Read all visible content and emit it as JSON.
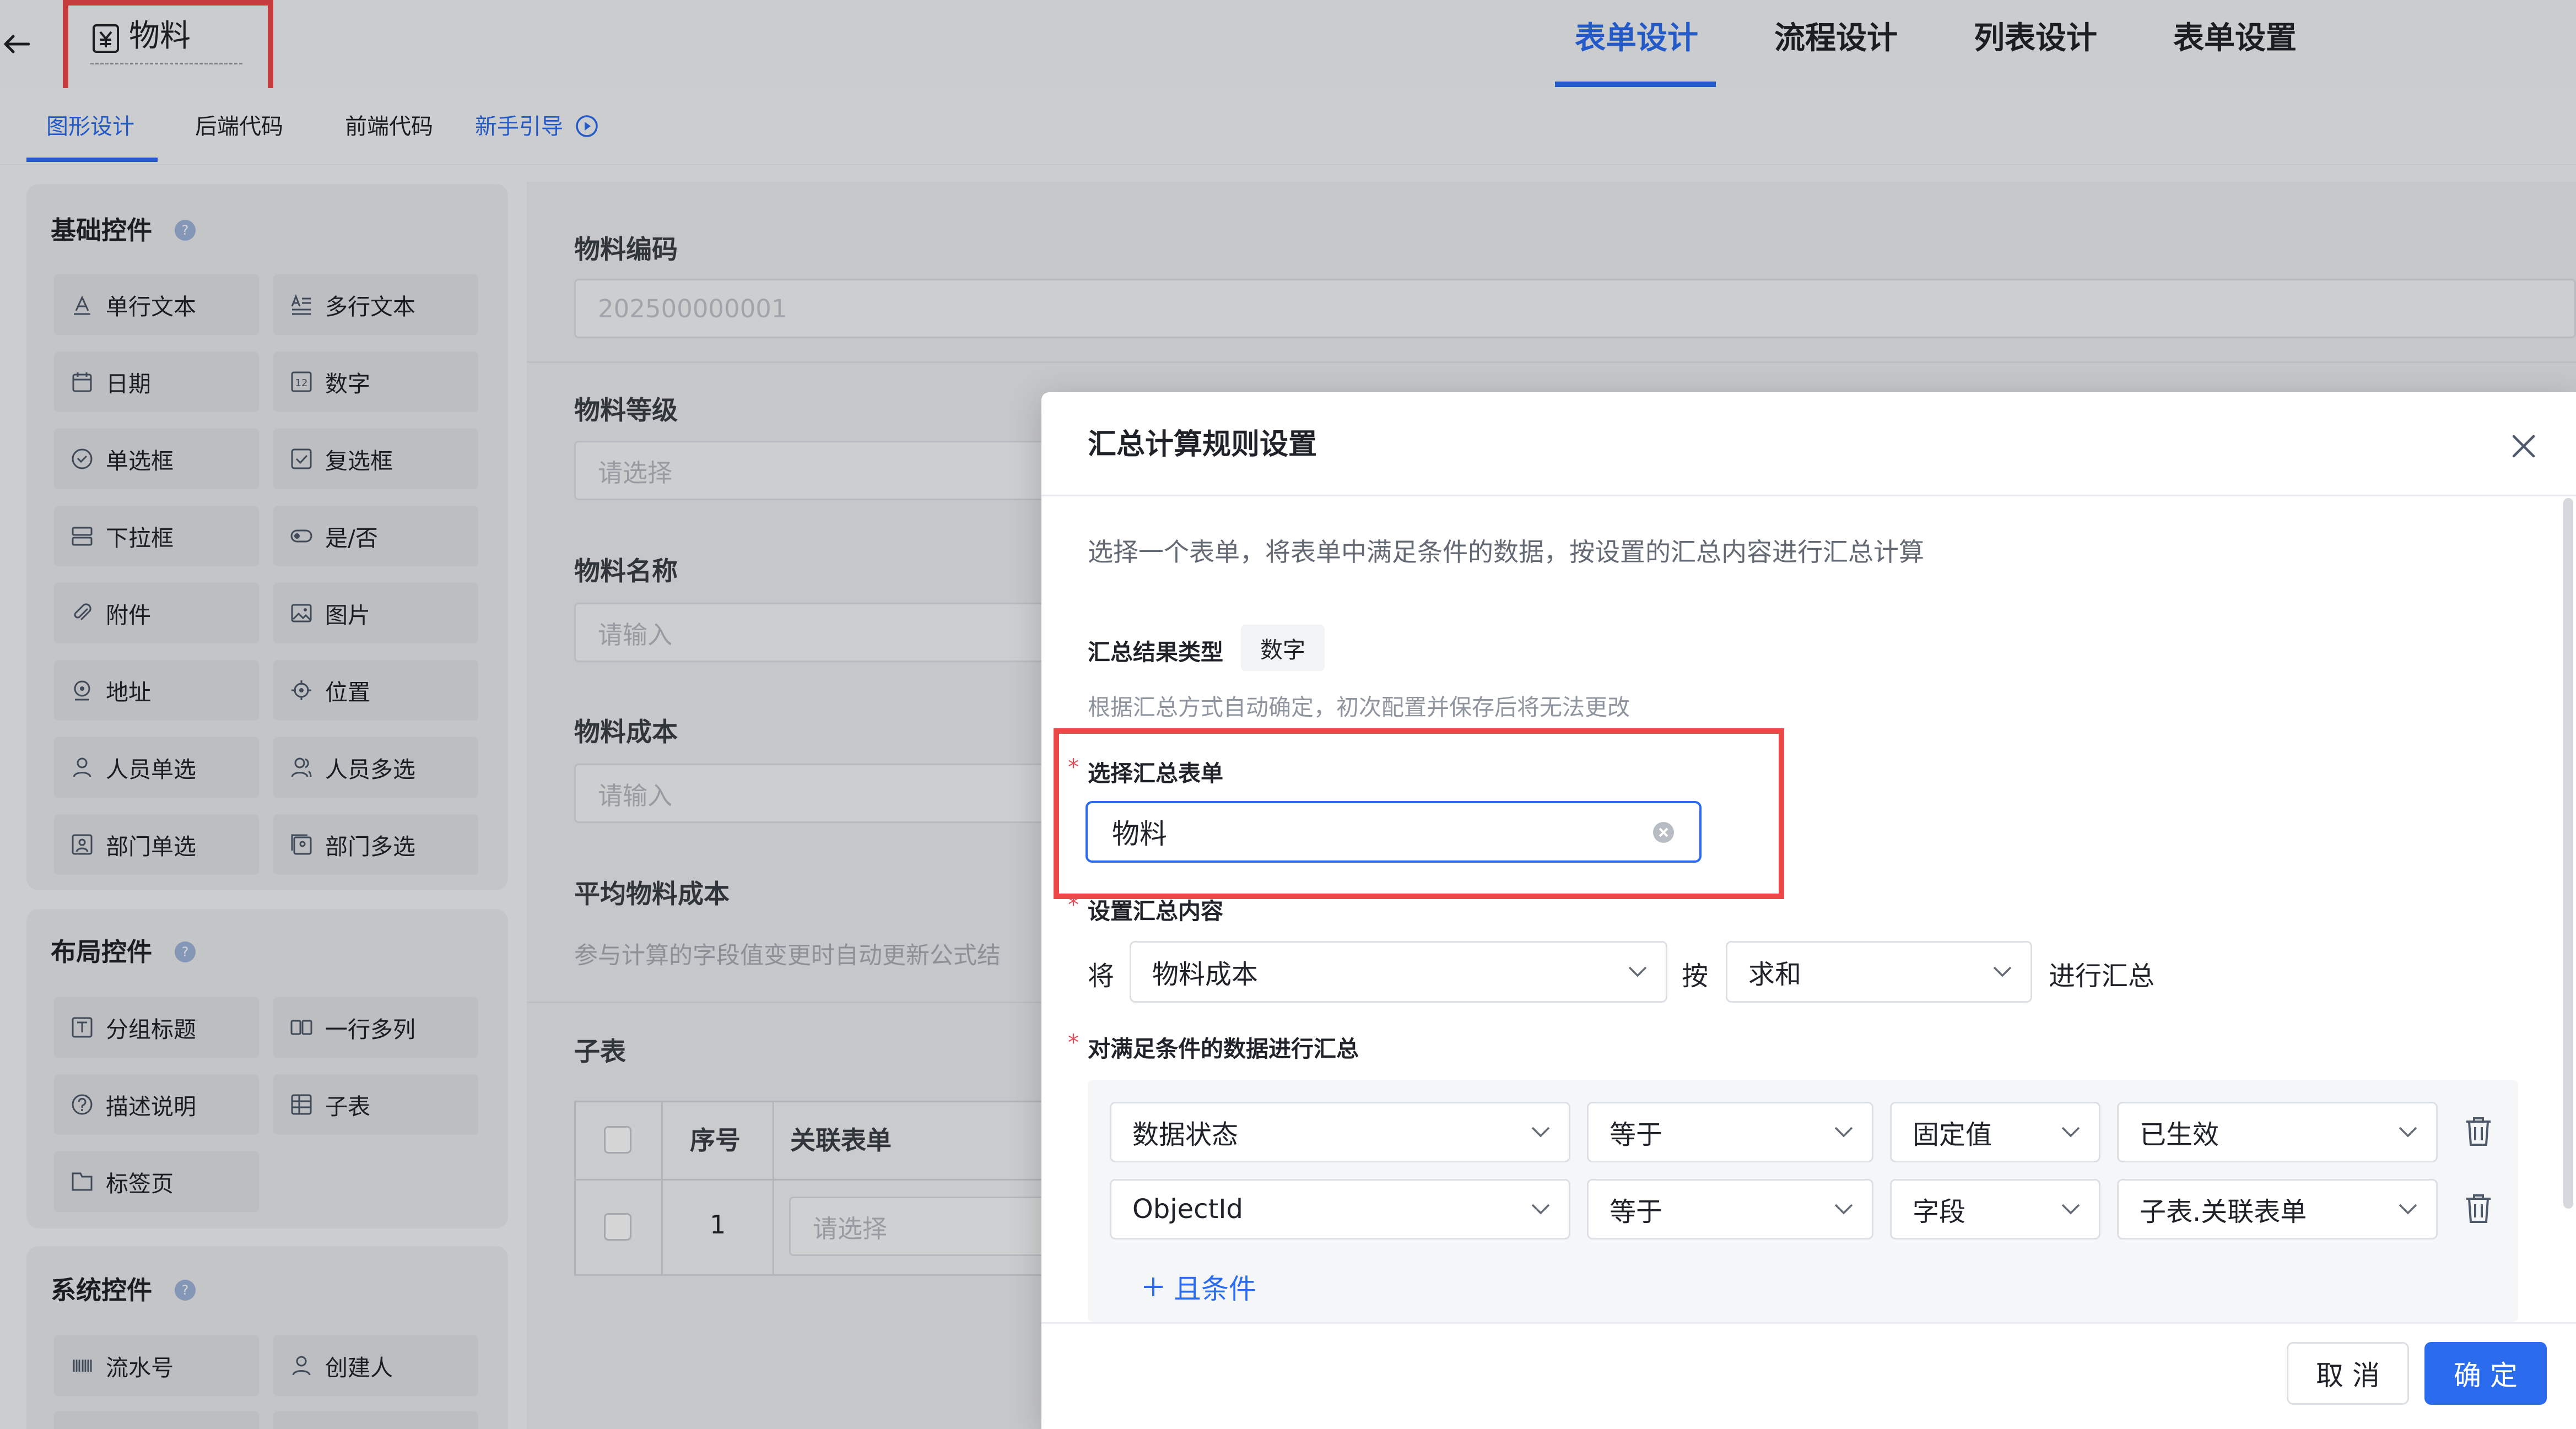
{
  "header": {
    "app_title": "物料",
    "tabs": [
      {
        "label": "表单设计",
        "active": true
      },
      {
        "label": "流程设计",
        "active": false
      },
      {
        "label": "列表设计",
        "active": false
      },
      {
        "label": "表单设置",
        "active": false
      }
    ]
  },
  "subtabs": [
    {
      "label": "图形设计",
      "active": true
    },
    {
      "label": "后端代码",
      "active": false
    },
    {
      "label": "前端代码",
      "active": false
    },
    {
      "label": "新手引导",
      "active": false,
      "icon": "play-circle-icon"
    }
  ],
  "palette": {
    "basic": {
      "title": "基础控件",
      "items": [
        {
          "label": "单行文本",
          "icon": "single-text-icon"
        },
        {
          "label": "多行文本",
          "icon": "multi-text-icon"
        },
        {
          "label": "日期",
          "icon": "calendar-icon"
        },
        {
          "label": "数字",
          "icon": "number-icon"
        },
        {
          "label": "单选框",
          "icon": "radio-icon"
        },
        {
          "label": "复选框",
          "icon": "checkbox-icon"
        },
        {
          "label": "下拉框",
          "icon": "dropdown-icon"
        },
        {
          "label": "是/否",
          "icon": "toggle-icon"
        },
        {
          "label": "附件",
          "icon": "paperclip-icon"
        },
        {
          "label": "图片",
          "icon": "image-icon"
        },
        {
          "label": "地址",
          "icon": "map-pin-icon"
        },
        {
          "label": "位置",
          "icon": "location-icon"
        },
        {
          "label": "人员单选",
          "icon": "user-icon"
        },
        {
          "label": "人员多选",
          "icon": "users-icon"
        },
        {
          "label": "部门单选",
          "icon": "department-icon"
        },
        {
          "label": "部门多选",
          "icon": "departments-icon"
        }
      ]
    },
    "layout": {
      "title": "布局控件",
      "items": [
        {
          "label": "分组标题",
          "icon": "group-title-icon"
        },
        {
          "label": "一行多列",
          "icon": "columns-icon"
        },
        {
          "label": "描述说明",
          "icon": "help-circle-icon"
        },
        {
          "label": "子表",
          "icon": "table-icon"
        },
        {
          "label": "标签页",
          "icon": "tabs-icon"
        }
      ]
    },
    "system": {
      "title": "系统控件",
      "items": [
        {
          "label": "流水号",
          "icon": "barcode-icon"
        },
        {
          "label": "创建人",
          "icon": "creator-icon"
        }
      ]
    }
  },
  "form": {
    "fields": [
      {
        "label": "物料编码",
        "value": "202500000001"
      },
      {
        "label": "物料等级",
        "placeholder": "请选择"
      },
      {
        "label": "物料名称",
        "placeholder": "请输入"
      },
      {
        "label": "物料成本",
        "placeholder": "请输入"
      }
    ],
    "avg_cost": {
      "label": "平均物料成本",
      "hint": "参与计算的字段值变更时自动更新公式结"
    },
    "subtable": {
      "label": "子表",
      "col_seq": "序号",
      "col_related": "关联表单",
      "row_seq": "1",
      "row_placeholder": "请选择"
    }
  },
  "modal": {
    "title": "汇总计算规则设置",
    "description": "选择一个表单，将表单中满足条件的数据，按设置的汇总内容进行汇总计算",
    "result_type_label": "汇总结果类型",
    "result_type_value": "数字",
    "result_type_hint": "根据汇总方式自动确定，初次配置并保存后将无法更改",
    "required_mark": "*",
    "select_form_label": "选择汇总表单",
    "select_form_value": "物料",
    "content_label": "设置汇总内容",
    "word_take": "将",
    "content_field": "物料成本",
    "word_by": "按",
    "content_method": "求和",
    "word_do": "进行汇总",
    "conditions_label": "对满足条件的数据进行汇总",
    "conditions": [
      {
        "field": "数据状态",
        "op": "等于",
        "type": "固定值",
        "value": "已生效"
      },
      {
        "field": "ObjectId",
        "op": "等于",
        "type": "字段",
        "value": "子表.关联表单"
      }
    ],
    "add_condition": "且条件",
    "cancel": "取 消",
    "ok": "确 定"
  },
  "colors": {
    "accent": "#2b6cee",
    "highlight_box": "#ec4848",
    "required": "#e34d59"
  }
}
